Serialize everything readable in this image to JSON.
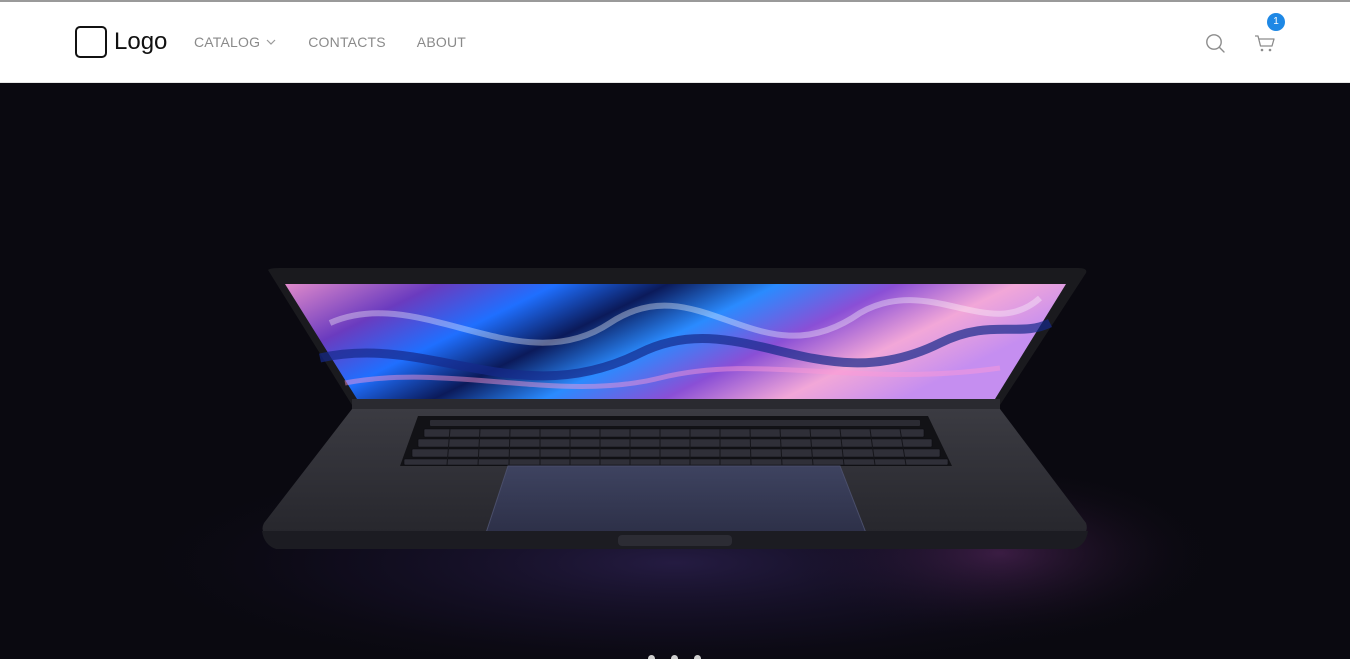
{
  "header": {
    "logo_text": "Logo",
    "nav": [
      {
        "label": "CATALOG",
        "has_dropdown": true
      },
      {
        "label": "CONTACTS"
      },
      {
        "label": "ABOUT"
      }
    ],
    "cart_count": "1",
    "icons": {
      "search": "search-icon",
      "cart": "cart-icon",
      "dropdown": "chevron-down-icon"
    }
  },
  "hero": {
    "image": "laptop-product-photo",
    "slides": 3,
    "background_color": "#0a0910"
  },
  "colors": {
    "badge": "#1e88e5",
    "nav_text": "#8a8a8a"
  }
}
